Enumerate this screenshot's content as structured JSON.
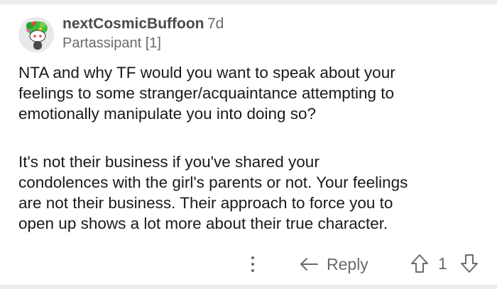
{
  "comment": {
    "username": "nextCosmicBuffoon",
    "age": "7d",
    "flair": "Partassipant [1]",
    "paragraphs": [
      [
        "NTA and why TF would you want to speak about your",
        "feelings to some stranger/acquaintance attempting to",
        "emotionally manipulate you into doing so?"
      ],
      [
        "It's not their business if you've shared your",
        "condolences with the girl's parents or not. Your feelings",
        "are not their business. Their approach to force you to",
        "open up shows a lot more about their true character."
      ]
    ]
  },
  "actions": {
    "more_icon": "vertical-ellipsis-icon",
    "reply_label": "Reply",
    "reply_icon": "reply-arrow-icon",
    "upvote_icon": "up-arrow-icon",
    "vote_count": "1",
    "downvote_icon": "down-arrow-icon"
  },
  "colors": {
    "text": "#1a1a1b",
    "muted": "#6a6a6a",
    "divider": "#ececec",
    "avatar_hair": "#3fbf3f",
    "avatar_flower": "#e8443a"
  }
}
